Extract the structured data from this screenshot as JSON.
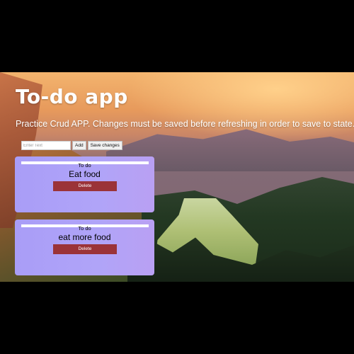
{
  "header": {
    "title": "To-do app",
    "subtitle": "Practice Crud APP. Changes must be saved before refreshing in order to save to state."
  },
  "form": {
    "input_placeholder": "Enter Text",
    "add_label": "Add",
    "save_label": "Save changes"
  },
  "todos": [
    {
      "label": "To do",
      "text": "Eat food",
      "delete_label": "Delete"
    },
    {
      "label": "To do",
      "text": "eat more food",
      "delete_label": "Delete"
    }
  ],
  "colors": {
    "card": "#aa9ef7",
    "delete_button": "#9b3338",
    "text_white": "#ffffff"
  }
}
